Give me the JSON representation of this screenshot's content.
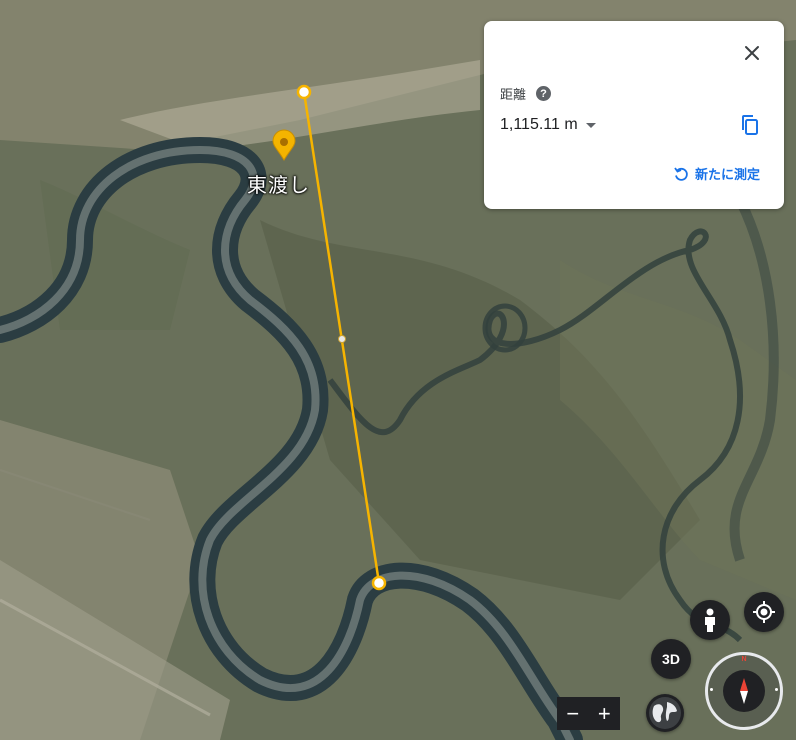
{
  "map": {
    "place_name": "東渡し",
    "colors": {
      "measure_line": "#f6b400",
      "marker": "#f4b400"
    }
  },
  "measure_panel": {
    "label": "距離",
    "help_icon": "?",
    "distance": "1,115.11 m",
    "remeasure_label": "新たに測定",
    "icons": [
      "close-icon",
      "help-icon",
      "dropdown-caret-icon",
      "copy-icon",
      "refresh-icon"
    ]
  },
  "controls": {
    "view_3d_label": "3D",
    "zoom_out": "−",
    "zoom_in": "+",
    "compass_north": "N",
    "icons": [
      "pegman-icon",
      "my-location-icon",
      "globe-icon",
      "compass-icon"
    ]
  }
}
